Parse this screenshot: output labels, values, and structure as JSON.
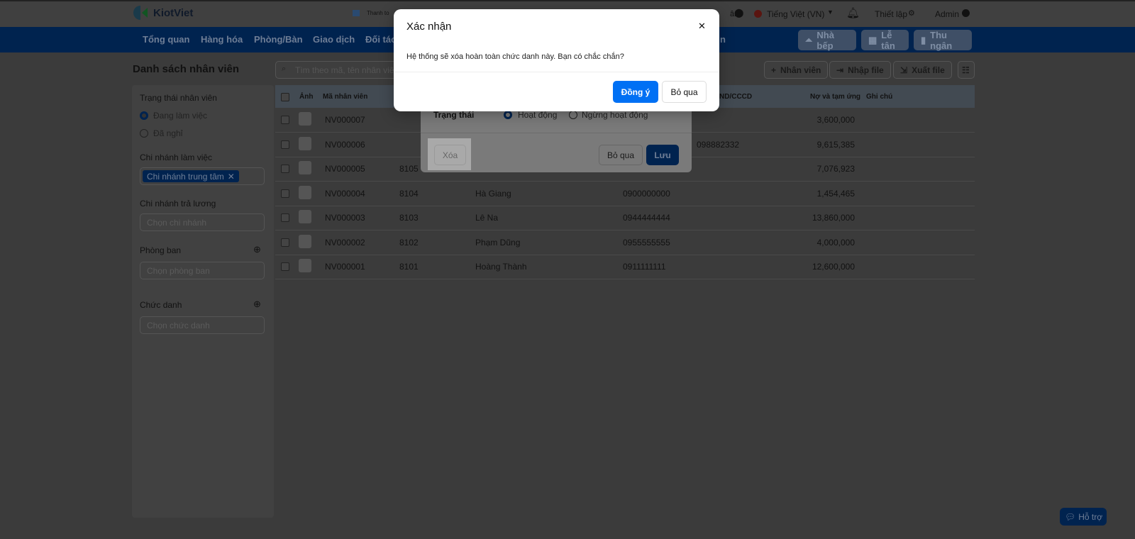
{
  "header": {
    "logo": "KiotViet",
    "payment": "Thanh to",
    "branch_partial": "âm",
    "language": "Tiếng Việt (VN)",
    "settings": "Thiết lập",
    "user": "Admin"
  },
  "nav": {
    "items": [
      "Tổng quan",
      "Hàng hóa",
      "Phòng/Bàn",
      "Giao dịch",
      "Đối tác"
    ],
    "partial": "n",
    "buttons": [
      "Nhà bếp",
      "Lễ tân",
      "Thu ngân"
    ]
  },
  "page": {
    "title": "Danh sách nhân viên",
    "search_placeholder": "Tìm theo mã, tên nhân viên",
    "add": "Nhân viên",
    "import": "Nhập file",
    "export": "Xuất file"
  },
  "filters": {
    "status_label": "Trạng thái nhân viên",
    "status_options": [
      "Đang làm việc",
      "Đã nghỉ"
    ],
    "status_selected": "Đang làm việc",
    "branch_label": "Chi nhánh làm việc",
    "branch_tag": "Chi nhánh trung tâm",
    "pay_branch_label": "Chi nhánh trả lương",
    "pay_branch_placeholder": "Chọn chi nhánh",
    "dept_label": "Phòng ban",
    "dept_placeholder": "Chọn phòng ban",
    "title_label": "Chức danh",
    "title_placeholder": "Chọn chức danh"
  },
  "table": {
    "headers": {
      "photo": "Ảnh",
      "code": "Mã nhân viên",
      "id_card": "ND/CCCD",
      "debt": "Nợ và tạm ứng",
      "note": "Ghi chú"
    },
    "rows": [
      {
        "code": "NV000007",
        "att": "",
        "name": "",
        "phone": "",
        "id_card": "",
        "debt": "3,600,000"
      },
      {
        "code": "NV000006",
        "att": "",
        "name": "",
        "phone": "",
        "id_card": "098882332",
        "debt": "9,615,385"
      },
      {
        "code": "NV000005",
        "att": "8105",
        "name": "",
        "phone": "",
        "id_card": "",
        "debt": "7,076,923"
      },
      {
        "code": "NV000004",
        "att": "8104",
        "name": "Hà Giang",
        "phone": "0900000000",
        "id_card": "",
        "debt": "1,454,465"
      },
      {
        "code": "NV000003",
        "att": "8103",
        "name": "Lê Na",
        "phone": "0944444444",
        "id_card": "",
        "debt": "13,860,000"
      },
      {
        "code": "NV000002",
        "att": "8102",
        "name": "Phạm Dũng",
        "phone": "0955555555",
        "id_card": "",
        "debt": "4,000,000"
      },
      {
        "code": "NV000001",
        "att": "8101",
        "name": "Hoàng Thành",
        "phone": "0911111111",
        "id_card": "",
        "debt": "12,600,000"
      }
    ]
  },
  "edit_modal": {
    "status_label": "Trạng thái",
    "options": [
      "Hoạt động",
      "Ngừng hoạt động"
    ],
    "selected": "Hoạt động",
    "delete": "Xóa",
    "cancel": "Bỏ qua",
    "save": "Lưu"
  },
  "confirm": {
    "title": "Xác nhận",
    "message": "Hệ thống sẽ xóa hoàn toàn chức danh này. Bạn có chắc chắn?",
    "ok": "Đồng ý",
    "cancel": "Bỏ qua"
  },
  "support": "Hỗ trợ",
  "colors": {
    "primary": "#0070f4",
    "nav": "#0052cc"
  }
}
